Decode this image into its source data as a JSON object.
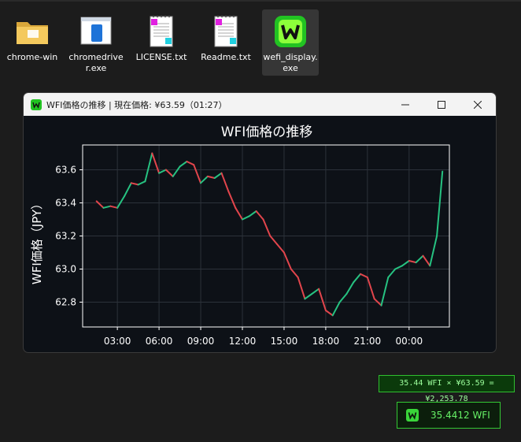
{
  "desktop": {
    "icons": [
      {
        "label": "chrome-win",
        "kind": "folder"
      },
      {
        "label": "chromedriver.exe",
        "kind": "exe"
      },
      {
        "label": "LICENSE.txt",
        "kind": "text"
      },
      {
        "label": "Readme.txt",
        "kind": "text"
      },
      {
        "label": "wefi_display.exe",
        "kind": "app",
        "selected": true
      }
    ]
  },
  "window": {
    "title": "WFI価格の推移 | 現在価格: ¥63.59（01:27）",
    "controls": {
      "minimize": "minimize-icon",
      "maximize": "maximize-icon",
      "close": "close-icon"
    }
  },
  "chart_data": {
    "type": "line",
    "title": "WFI価格の推移",
    "ylabel": "WFI価格（JPY）",
    "xlabel": "",
    "ylim": [
      62.65,
      63.75
    ],
    "xlim": [
      0.5,
      26.9
    ],
    "grid": true,
    "yticks": [
      62.8,
      63.0,
      63.2,
      63.4,
      63.6
    ],
    "xticks": [
      {
        "label": "03:00",
        "hour": 3
      },
      {
        "label": "06:00",
        "hour": 6
      },
      {
        "label": "09:00",
        "hour": 9
      },
      {
        "label": "12:00",
        "hour": 12
      },
      {
        "label": "15:00",
        "hour": 15
      },
      {
        "label": "18:00",
        "hour": 18
      },
      {
        "label": "21:00",
        "hour": 21
      },
      {
        "label": "00:00",
        "hour": 24
      }
    ],
    "colors": {
      "up": "#26c281",
      "down": "#e2454c",
      "grid": "#2c323a",
      "bg": "#0d1117"
    },
    "x_hours": [
      1.5,
      2.0,
      2.5,
      3.0,
      3.5,
      4.0,
      4.5,
      5.0,
      5.5,
      6.0,
      6.5,
      7.0,
      7.5,
      8.0,
      8.5,
      9.0,
      9.5,
      10.0,
      10.5,
      11.0,
      11.5,
      12.0,
      12.5,
      13.0,
      13.5,
      14.0,
      14.5,
      15.0,
      15.5,
      16.0,
      16.5,
      17.0,
      17.5,
      18.0,
      18.5,
      19.0,
      19.5,
      20.0,
      20.5,
      21.0,
      21.5,
      22.0,
      22.5,
      23.0,
      23.5,
      24.0,
      24.5,
      25.0,
      25.5,
      26.0,
      26.4
    ],
    "values": [
      63.41,
      63.37,
      63.38,
      63.37,
      63.44,
      63.52,
      63.51,
      63.53,
      63.7,
      63.58,
      63.6,
      63.56,
      63.62,
      63.65,
      63.63,
      63.52,
      63.56,
      63.55,
      63.58,
      63.47,
      63.37,
      63.3,
      63.32,
      63.35,
      63.3,
      63.2,
      63.15,
      63.1,
      63.0,
      62.95,
      62.82,
      62.85,
      62.88,
      62.75,
      62.72,
      62.8,
      62.85,
      62.92,
      62.97,
      62.95,
      62.82,
      62.78,
      62.95,
      63.0,
      63.02,
      63.05,
      63.04,
      63.08,
      63.02,
      63.2,
      63.59
    ]
  },
  "overlay": {
    "calc_text": "35.44 WFI × ¥63.59 = ¥2,253.78",
    "widget_value": "35.4412 WFI"
  }
}
